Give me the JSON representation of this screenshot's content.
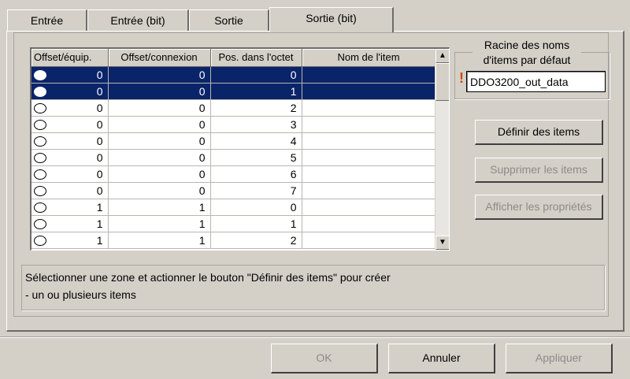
{
  "tabs": [
    {
      "label": "Entrée"
    },
    {
      "label": "Entrée (bit)"
    },
    {
      "label": "Sortie"
    },
    {
      "label": "Sortie (bit)"
    }
  ],
  "grid": {
    "headers": [
      "Offset/équip.",
      "Offset/connexion",
      "Pos. dans l'octet",
      "Nom de l'item"
    ],
    "rows": [
      {
        "equip": "0",
        "conn": "0",
        "pos": "0",
        "name": "",
        "selected": true
      },
      {
        "equip": "0",
        "conn": "0",
        "pos": "1",
        "name": "",
        "selected": true
      },
      {
        "equip": "0",
        "conn": "0",
        "pos": "2",
        "name": "",
        "selected": false
      },
      {
        "equip": "0",
        "conn": "0",
        "pos": "3",
        "name": "",
        "selected": false
      },
      {
        "equip": "0",
        "conn": "0",
        "pos": "4",
        "name": "",
        "selected": false
      },
      {
        "equip": "0",
        "conn": "0",
        "pos": "5",
        "name": "",
        "selected": false
      },
      {
        "equip": "0",
        "conn": "0",
        "pos": "6",
        "name": "",
        "selected": false
      },
      {
        "equip": "0",
        "conn": "0",
        "pos": "7",
        "name": "",
        "selected": false
      },
      {
        "equip": "1",
        "conn": "1",
        "pos": "0",
        "name": "",
        "selected": false
      },
      {
        "equip": "1",
        "conn": "1",
        "pos": "1",
        "name": "",
        "selected": false
      },
      {
        "equip": "1",
        "conn": "1",
        "pos": "2",
        "name": "",
        "selected": false
      }
    ],
    "scroll_up": "▲",
    "scroll_down": "▼"
  },
  "root_group": {
    "title": "Racine des noms d'items par défaut",
    "warning_icon": "exclamation-icon",
    "value": "DDO3200_out_data"
  },
  "buttons": {
    "define": "Définir des items",
    "delete": "Supprimer les items",
    "properties": "Afficher les propriétés"
  },
  "status": {
    "line1": "Sélectionner une zone et actionner le bouton \"Définir des items\" pour créer",
    "line2": "- un ou plusieurs items"
  },
  "footer": {
    "ok": "OK",
    "cancel": "Annuler",
    "apply": "Appliquer"
  },
  "colors": {
    "selection": "#0a246a",
    "dialog_bg": "#d4d0c8",
    "warning": "#d04a00"
  }
}
